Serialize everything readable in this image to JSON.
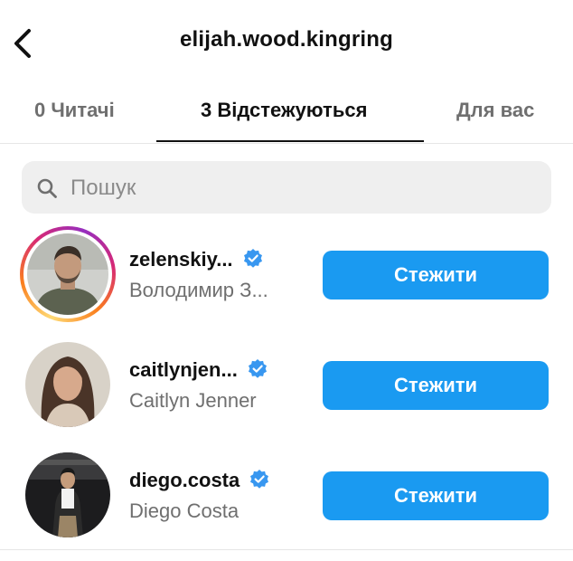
{
  "header": {
    "title": "elijah.wood.kingring",
    "back_icon": "chevron-left-icon"
  },
  "tabs": [
    {
      "label": "0 Читачі",
      "active": false
    },
    {
      "label": "3 Відстежуються",
      "active": true
    },
    {
      "label": "Для вас",
      "active": false
    }
  ],
  "search": {
    "placeholder": "Пошук",
    "value": "",
    "icon": "search-icon"
  },
  "accounts": [
    {
      "username": "zelenskiy...",
      "name": "Володимир З...",
      "verified": true,
      "has_story": true,
      "button": "Стежити"
    },
    {
      "username": "caitlynjen...",
      "name": "Caitlyn Jenner",
      "verified": true,
      "has_story": false,
      "button": "Стежити"
    },
    {
      "username": "diego.costa",
      "name": "Diego Costa",
      "verified": true,
      "has_story": false,
      "button": "Стежити"
    }
  ],
  "colors": {
    "accent": "#1a9af1",
    "verified": "#3897f0",
    "secondary_text": "#6f6f6f"
  }
}
